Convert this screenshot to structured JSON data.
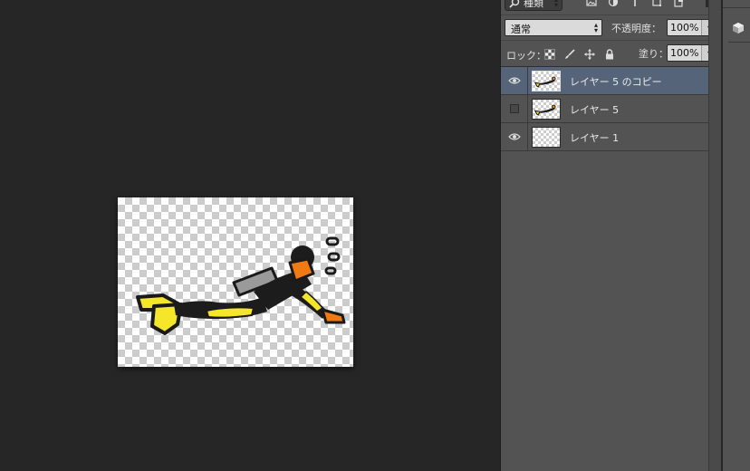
{
  "layers_panel": {
    "filter": {
      "label": "種類"
    },
    "blend_mode": "通常",
    "opacity_label": "不透明度：",
    "opacity_value": "100%",
    "lock_label": "ロック：",
    "fill_label": "塗り：",
    "fill_value": "100%",
    "layers": [
      {
        "name": "レイヤー 5 のコピー",
        "visible": true,
        "selected": true
      },
      {
        "name": "レイヤー 5",
        "visible": false,
        "selected": false
      },
      {
        "name": "レイヤー 1",
        "visible": true,
        "selected": false
      }
    ]
  },
  "icons": {
    "filter": "search-icon",
    "filter_kinds": [
      "image-filter-icon",
      "adjustment-filter-icon",
      "type-filter-icon",
      "shape-filter-icon",
      "smart-object-filter-icon"
    ],
    "locks": [
      "lock-transparent-pixels-icon",
      "lock-image-pixels-icon",
      "lock-position-icon",
      "lock-all-icon"
    ],
    "visibility": "eye-icon",
    "dock": "3d-cube-icon"
  },
  "colors": {
    "canvas_background": "#262626",
    "panel_background": "#535353",
    "selected_layer": "#566479",
    "diver_fin": "#f5e62a",
    "diver_face": "#f27a12",
    "diver_tank": "#9a9a9a",
    "diver_suit": "#1c1c1c"
  }
}
